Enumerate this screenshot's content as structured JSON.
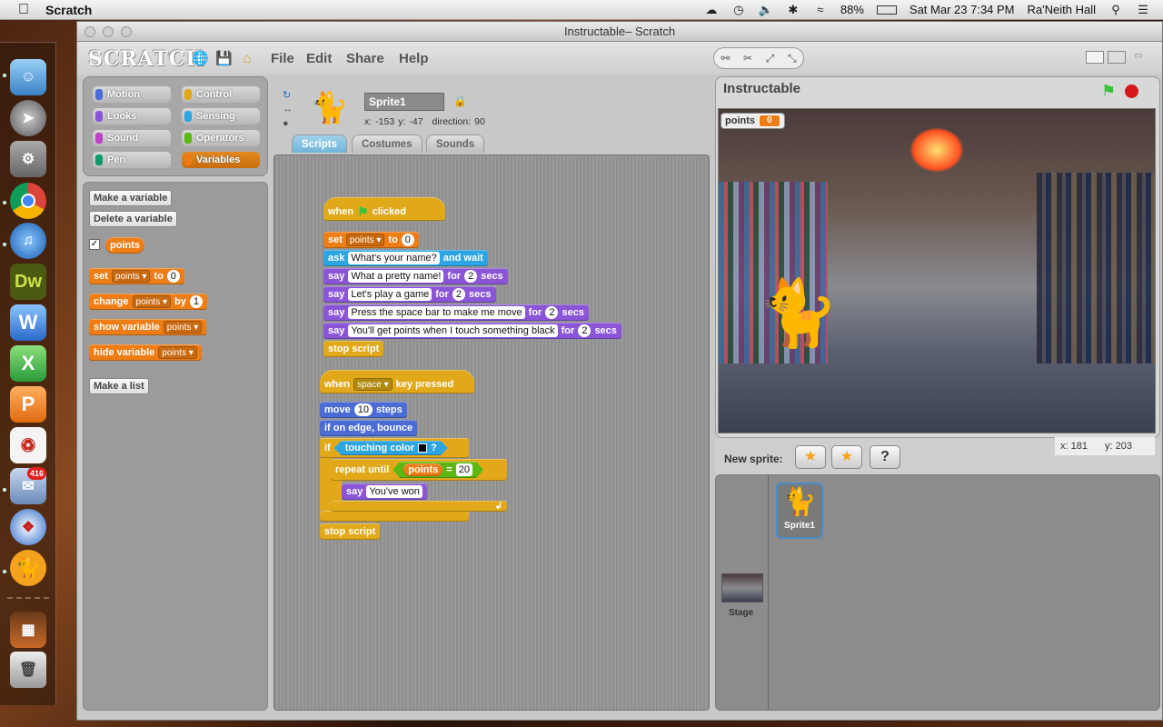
{
  "menubar": {
    "app_name": "Scratch",
    "battery": "88%",
    "datetime": "Sat Mar 23  7:34 PM",
    "user": "Ra'Neith Hall"
  },
  "dock": {
    "mail_badge": "416"
  },
  "window": {
    "title": "Instructable– Scratch"
  },
  "scratch": {
    "logo": "SCRATCH",
    "menus": [
      "File",
      "Edit",
      "Share",
      "Help"
    ]
  },
  "categories": {
    "motion": "Motion",
    "control": "Control",
    "looks": "Looks",
    "sensing": "Sensing",
    "sound": "Sound",
    "operators": "Operators",
    "pen": "Pen",
    "variables": "Variables",
    "colors": {
      "motion": "#4a6cd4",
      "control": "#e1a91a",
      "looks": "#8a55d7",
      "sensing": "#2ca5e2",
      "sound": "#bb42c3",
      "operators": "#5cb712",
      "pen": "#0e9a6c",
      "variables": "#ee7d16"
    }
  },
  "palette": {
    "make_variable": "Make a variable",
    "delete_variable": "Delete a variable",
    "variable_name": "points",
    "set_label": "set",
    "set_to": "to",
    "set_value": "0",
    "change_label": "change",
    "change_by": "by",
    "change_value": "1",
    "show_variable": "show variable",
    "hide_variable": "hide variable",
    "make_list": "Make a list"
  },
  "sprite": {
    "name": "Sprite1",
    "x_label": "x:",
    "x": "-153",
    "y_label": "y:",
    "y": "-47",
    "direction_label": "direction:",
    "direction": "90"
  },
  "tabs": [
    "Scripts",
    "Costumes",
    "Sounds"
  ],
  "script1": {
    "when": "when",
    "clicked": "clicked",
    "set": "set",
    "var": "points",
    "to": "to",
    "set_val": "0",
    "ask": "ask",
    "ask_text": "What's your name?",
    "and_wait": "and wait",
    "say": "say",
    "for": "for",
    "secs": "secs",
    "say1": "What a pretty name!",
    "say2": "Let's play a game",
    "say3": "Press the space bar to make me move",
    "say4": "You'll get points when I touch something black",
    "secs_val": "2",
    "stop": "stop script"
  },
  "script2": {
    "when": "when",
    "key": "space",
    "key_pressed": "key pressed",
    "move": "move",
    "steps_val": "10",
    "steps": "steps",
    "bounce": "if on edge, bounce",
    "if": "if",
    "touching": "touching color",
    "q": "?",
    "repeat": "repeat until",
    "var": "points",
    "eq": "=",
    "eq_val": "20",
    "say": "say",
    "say_text": "You've won",
    "stop": "stop script"
  },
  "stage": {
    "title": "Instructable",
    "monitor_label": "points",
    "monitor_value": "0",
    "mouse_x_label": "x:",
    "mouse_x": "181",
    "mouse_y_label": "y:",
    "mouse_y": "203"
  },
  "sprites_panel": {
    "new_sprite": "New sprite:",
    "sprite1": "Sprite1",
    "stage": "Stage"
  }
}
